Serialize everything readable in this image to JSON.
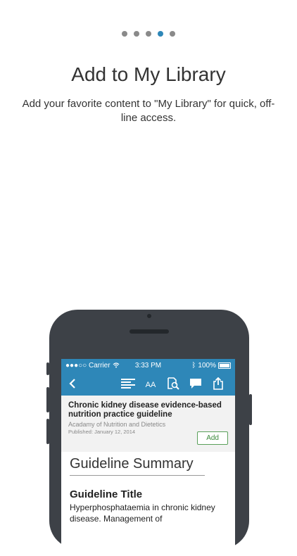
{
  "pager": {
    "count": 5,
    "active_index": 3
  },
  "header": {
    "title": "Add to My Library",
    "subtitle": "Add your favorite content to \"My Library\" for quick, off-line access."
  },
  "phone": {
    "status": {
      "carrier": "●●●○○ Carrier",
      "time": "3:33 PM",
      "battery": "100%"
    },
    "toolbar": {
      "back_icon": "chevron-left-icon",
      "icons": [
        "list-icon",
        "text-size-icon",
        "search-document-icon",
        "comment-icon",
        "share-icon"
      ],
      "text_size_label": "AA"
    },
    "article": {
      "title": "Chronic kidney disease evidence-based nutrition practice guideline",
      "organization": "Acadamy of Nutrition and Dietetics",
      "published": "Published: January 12, 2014",
      "add_label": "Add"
    },
    "content": {
      "section_heading": "Guideline Summary",
      "guideline_title": "Guideline Title",
      "guideline_text": "Hyperphosphataemia in chronic kidney disease. Management of"
    }
  },
  "colors": {
    "accent": "#2e87b8",
    "dot_inactive": "#8a8a8a",
    "add_green": "#3a8a3a"
  }
}
